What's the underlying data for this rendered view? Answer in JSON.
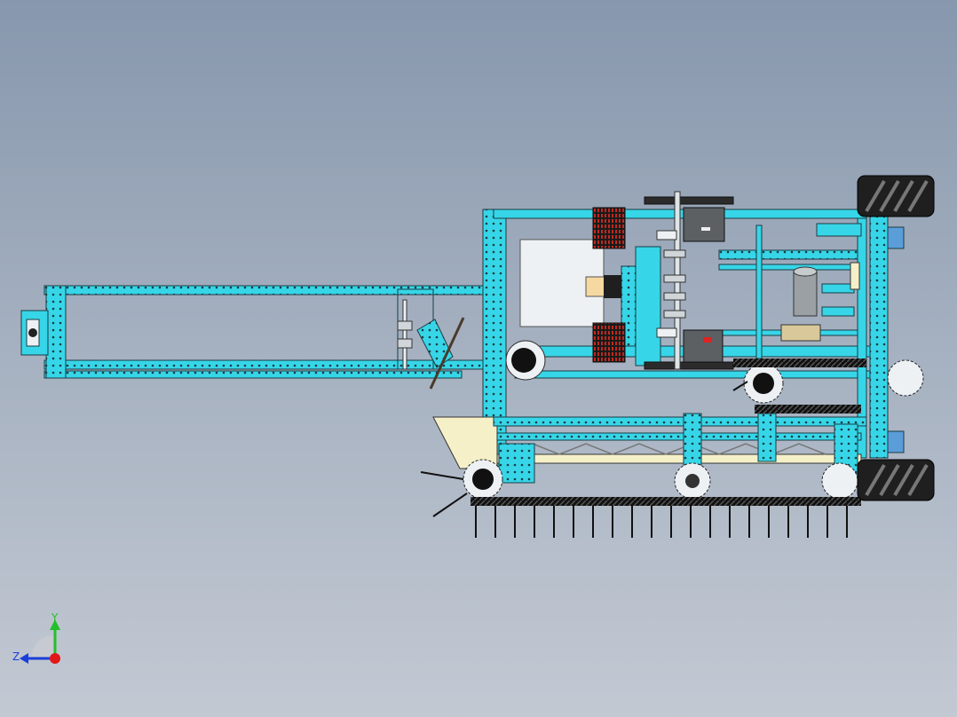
{
  "viewport": {
    "background_top": "#8797ad",
    "background_bottom": "#c3c9d3"
  },
  "colors": {
    "frame": "#36d6e8",
    "frame_edge": "#1b3c44",
    "hole": "#1b3c44",
    "panel": "#eef1f4",
    "tread": "#f5f0c8",
    "motor": "#5c6063",
    "wheel": "#222222",
    "gear": "#3a3a3a",
    "tine": "#111111"
  },
  "triad": {
    "y_label": "Y",
    "z_label": "Z",
    "y_color": "#22c02b",
    "z_color": "#1c3fd8",
    "x_color": "#e01818"
  },
  "parts": [
    "left-arm-frame",
    "bumper-bracket",
    "main-chassis",
    "collector-conveyor",
    "mecanum-wheels",
    "drive-motors",
    "gear-train",
    "spiked-rollers",
    "servo-motor",
    "tine-comb"
  ]
}
